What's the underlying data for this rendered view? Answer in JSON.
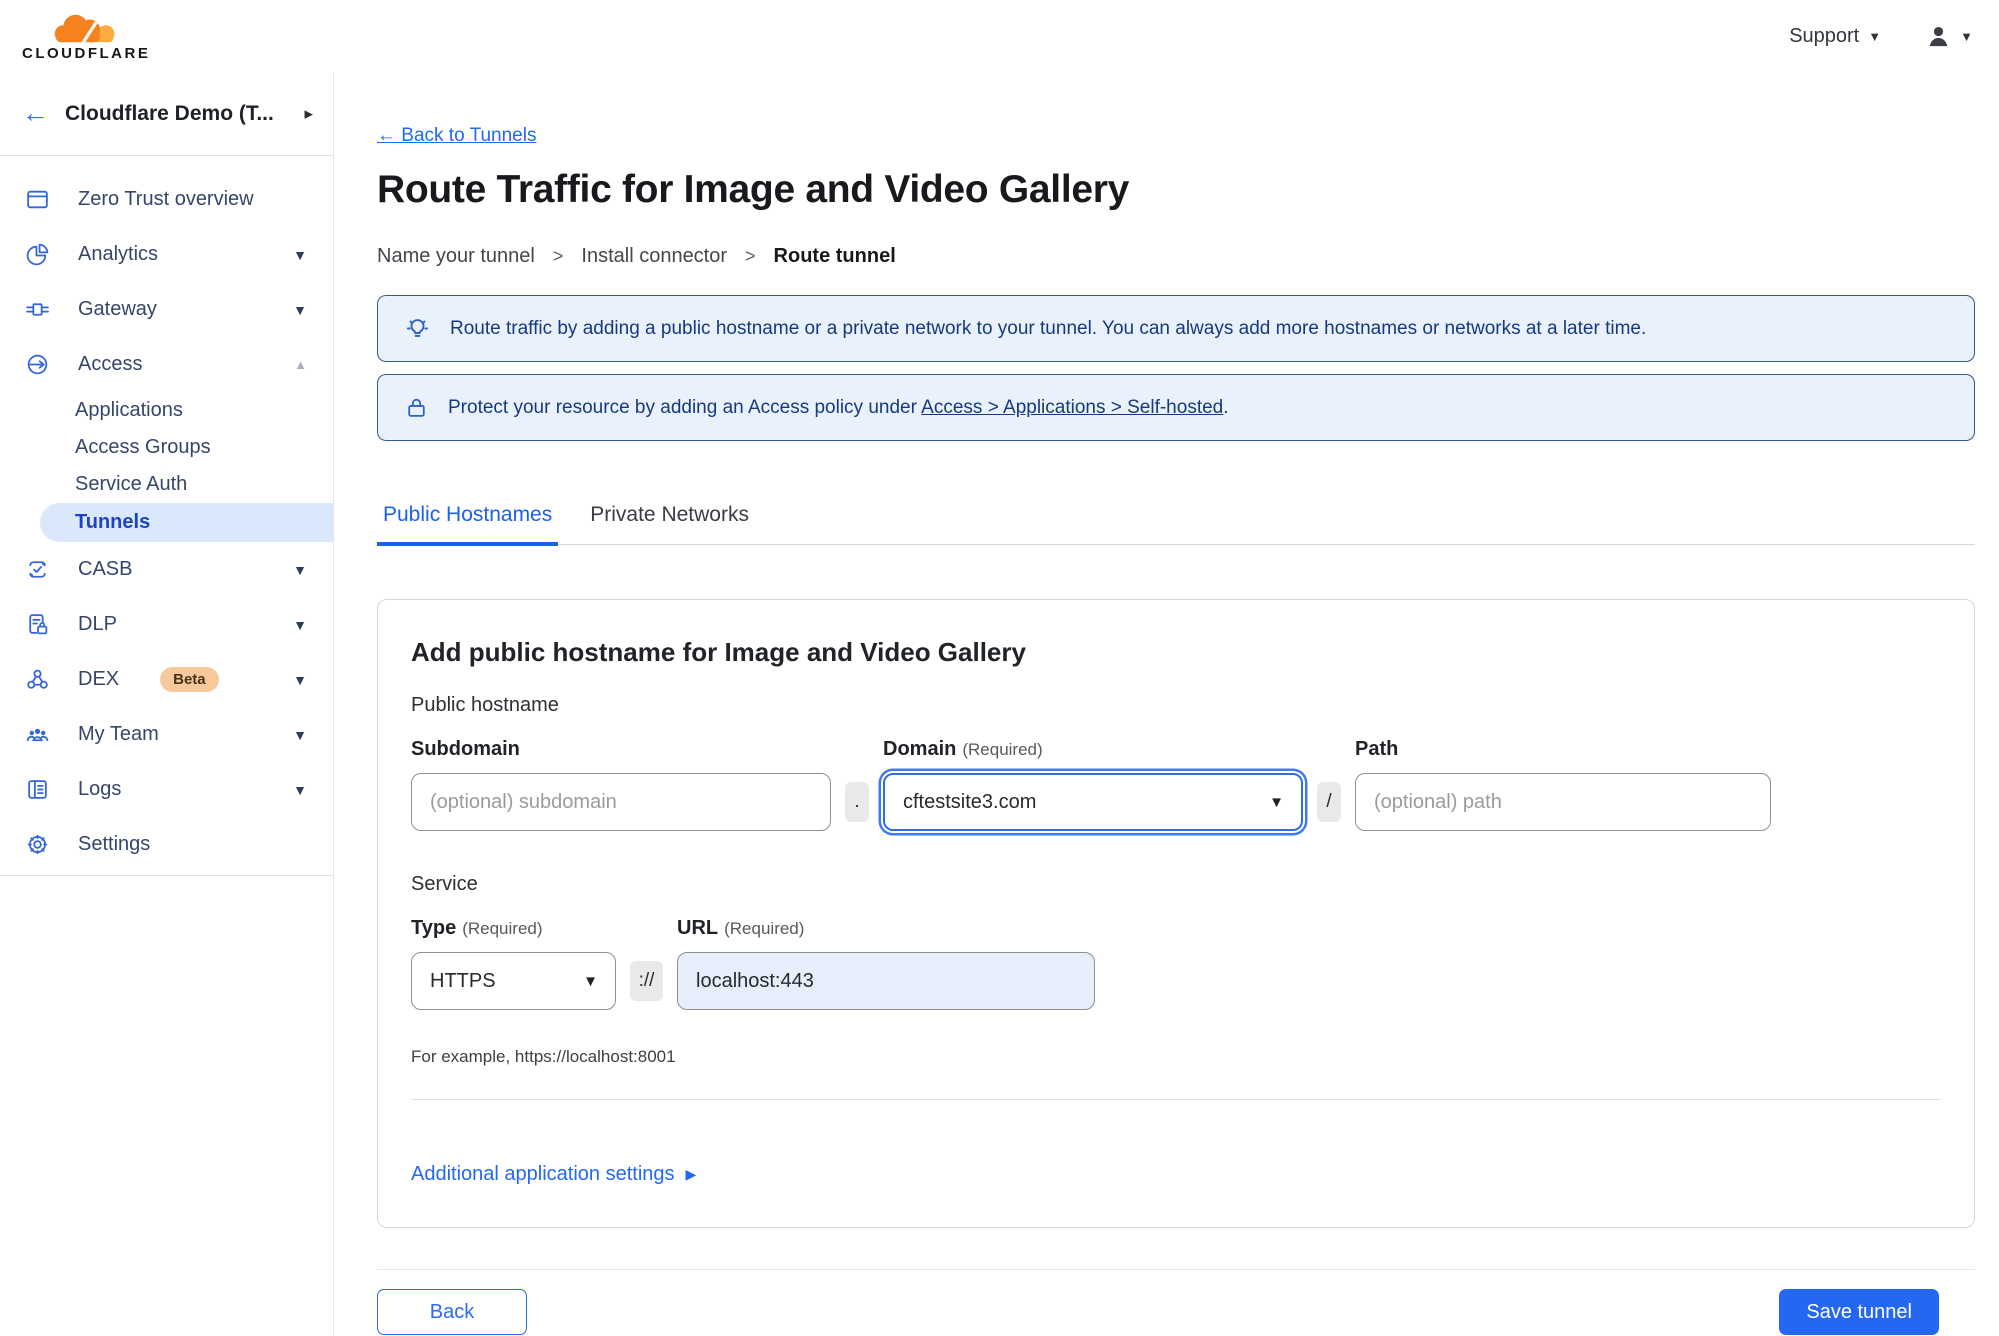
{
  "header": {
    "logo_text": "CLOUDFLARE",
    "support_label": "Support"
  },
  "sidebar": {
    "back_arrow": "←",
    "account_name": "Cloudflare Demo (T...",
    "items": {
      "overview": "Zero Trust overview",
      "analytics": "Analytics",
      "gateway": "Gateway",
      "access": "Access",
      "applications": "Applications",
      "access_groups": "Access Groups",
      "service_auth": "Service Auth",
      "tunnels": "Tunnels",
      "casb": "CASB",
      "dlp": "DLP",
      "dex": "DEX",
      "dex_badge": "Beta",
      "my_team": "My Team",
      "logs": "Logs",
      "settings": "Settings"
    }
  },
  "main": {
    "back_link": "← Back to Tunnels",
    "title": "Route Traffic for Image and Video Gallery",
    "breadcrumb": [
      "Name your tunnel",
      "Install connector",
      "Route tunnel"
    ],
    "breadcrumb_sep": ">",
    "banner_tip": "Route traffic by adding a public hostname or a private network to your tunnel. You can always add more hostnames or networks at a later time.",
    "banner_lock_prefix": "Protect your resource by adding an Access policy under",
    "banner_lock_link": "Access > Applications > Self-hosted",
    "banner_lock_suffix": ".",
    "tabs": [
      "Public Hostnames",
      "Private Networks"
    ],
    "card": {
      "heading": "Add public hostname for Image and Video Gallery",
      "public_hostname_label": "Public hostname",
      "subdomain_label": "Subdomain",
      "subdomain_placeholder": "(optional) subdomain",
      "domain_label": "Domain",
      "required_label": "(Required)",
      "domain_value": "cftestsite3.com",
      "dot_separator": ".",
      "slash_separator": "/",
      "path_label": "Path",
      "path_placeholder": "(optional) path",
      "service_label": "Service",
      "type_label": "Type",
      "type_value": "HTTPS",
      "protocol_separator": "://",
      "url_label": "URL",
      "url_value": "localhost:443",
      "example_text": "For example, https://localhost:8001",
      "additional_settings": "Additional application settings"
    },
    "footer": {
      "back_button": "Back",
      "save_button": "Save tunnel"
    }
  },
  "colors": {
    "accent_blue": "#1f6af2",
    "banner_bg": "#e9f1fc",
    "banner_border": "#33598f",
    "cloud_orange": "#f6821f",
    "cloud_light_orange": "#fbad41",
    "beta_badge_bg": "#f7c89a"
  }
}
